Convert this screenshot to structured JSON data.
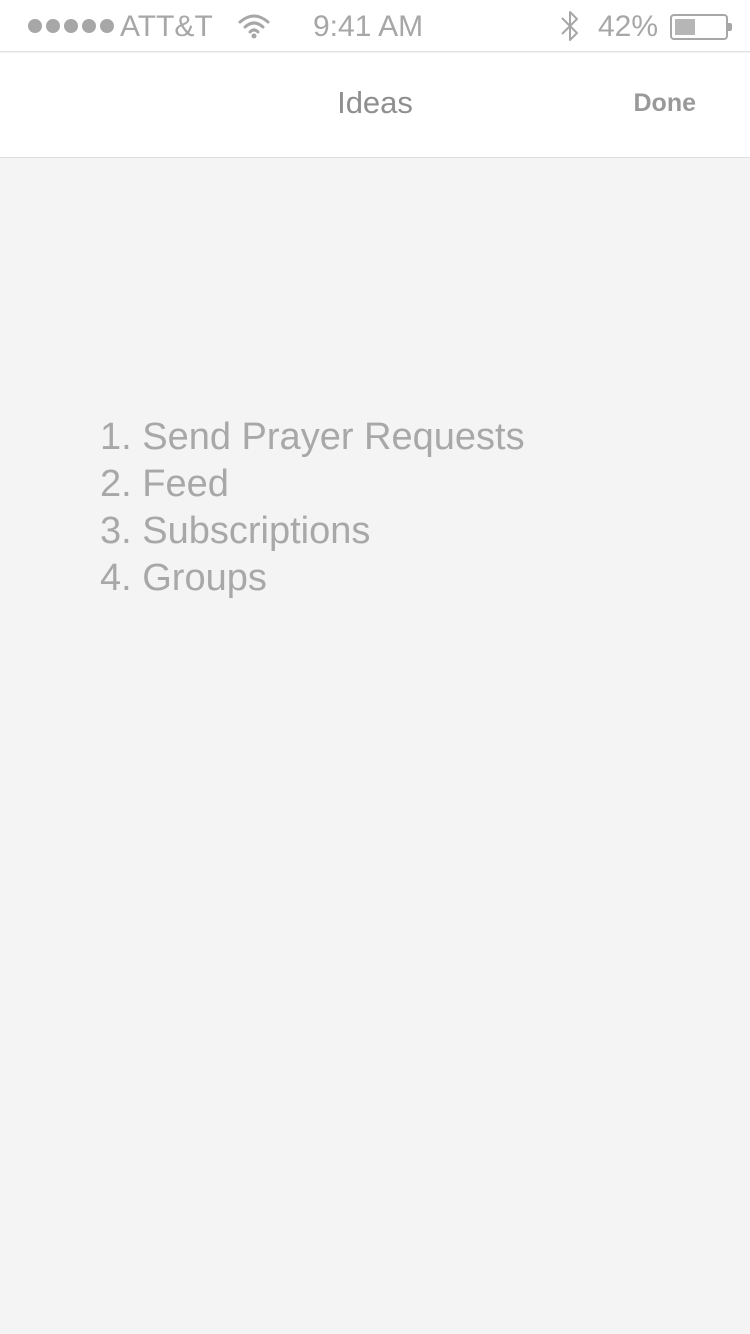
{
  "status_bar": {
    "carrier": "ATT&T",
    "time": "9:41 AM",
    "battery_percent": "42%",
    "battery_level": 0.42,
    "icons": [
      "signal-dots-icon",
      "wifi-icon",
      "bluetooth-icon",
      "battery-icon"
    ]
  },
  "nav": {
    "title": "Ideas",
    "done_label": "Done"
  },
  "ideas": [
    {
      "text": "1. Send Prayer Requests"
    },
    {
      "text": "2. Feed"
    },
    {
      "text": "3. Subscriptions"
    },
    {
      "text": "4. Groups"
    }
  ],
  "colors": {
    "background": "#f3f4f3",
    "text_muted": "#a8a8a8",
    "bar_background": "#ffffff"
  }
}
